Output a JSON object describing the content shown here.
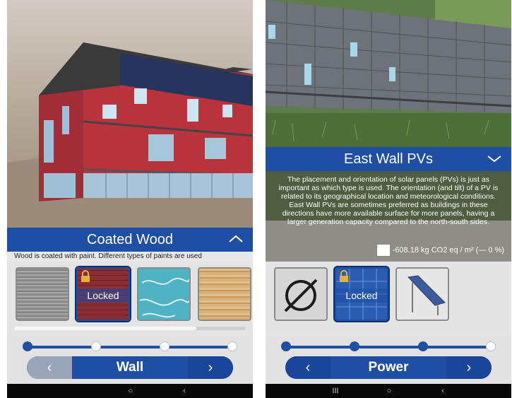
{
  "left": {
    "panel_title": "Coated Wood",
    "description_preview": "Wood is coated with paint. Different types of paints are used",
    "options": [
      {
        "name": "gray-wood"
      },
      {
        "name": "red-wood",
        "locked_label": "Locked"
      },
      {
        "name": "teal-pattern"
      },
      {
        "name": "natural-wood"
      }
    ],
    "slider": {
      "steps": 4,
      "active_steps": 1
    },
    "nav": {
      "prev": "‹",
      "title": "Wall",
      "next": "›"
    },
    "android_nav": [
      "○",
      "‹"
    ]
  },
  "right": {
    "panel_title": "East Wall PVs",
    "description": "The placement and orientation of solar panels (PVs) is just as important as which type is used. The orientation (and tilt) of a PV is related to its geographical location and meteorological conditions. East Wall PVs are sometimes preferred as buildings in these directions have more available surface for more panels, having a larger generation capacity compared to the north-south sides.",
    "metric": "-608.18 kg CO2 eq / m² (— 0 %)",
    "options": [
      {
        "name": "none"
      },
      {
        "name": "wall-pv",
        "locked_label": "Locked"
      },
      {
        "name": "tilted-pv"
      }
    ],
    "slider": {
      "steps": 4,
      "active_steps": 3
    },
    "nav": {
      "prev": "‹",
      "title": "Power",
      "next": "›"
    },
    "android_nav": [
      "III",
      "○",
      "‹"
    ]
  },
  "colors": {
    "accent": "#1e4fa5",
    "wall_red": "#b8333b"
  }
}
